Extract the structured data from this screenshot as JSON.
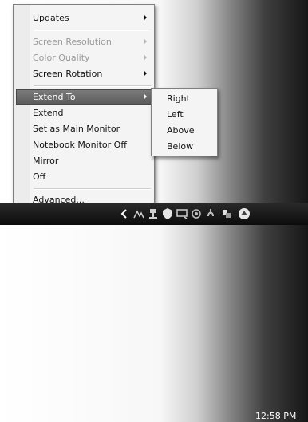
{
  "menu": {
    "items": [
      {
        "label": "Updates",
        "disabled": false,
        "has_submenu": true
      },
      {
        "label": "Screen Resolution",
        "disabled": true,
        "has_submenu": true
      },
      {
        "label": "Color Quality",
        "disabled": true,
        "has_submenu": true
      },
      {
        "label": "Screen Rotation",
        "disabled": false,
        "has_submenu": true
      },
      {
        "label": "Extend To",
        "disabled": false,
        "has_submenu": true,
        "selected": true
      },
      {
        "label": "Extend",
        "disabled": false,
        "has_submenu": false
      },
      {
        "label": "Set as Main Monitor",
        "disabled": false,
        "has_submenu": false
      },
      {
        "label": "Notebook Monitor Off",
        "disabled": false,
        "has_submenu": false
      },
      {
        "label": "Mirror",
        "disabled": false,
        "has_submenu": false
      },
      {
        "label": "Off",
        "disabled": false,
        "has_submenu": false
      },
      {
        "label": "Advanced...",
        "disabled": false,
        "has_submenu": false
      }
    ]
  },
  "submenu": {
    "items": [
      {
        "label": "Right"
      },
      {
        "label": "Left"
      },
      {
        "label": "Above"
      },
      {
        "label": "Below"
      }
    ]
  },
  "taskbar": {
    "clock": "12:58 PM",
    "tray_icons": [
      "chevron-left-icon",
      "network-icon",
      "usb-icon",
      "shield-icon",
      "display-icon",
      "signal-icon",
      "power-icon",
      "monitor-switch-icon"
    ]
  },
  "colors": {
    "menu_bg": "#f4f4f4",
    "selected_bg": "#6a6a6a",
    "disabled_text": "#9a9a9a",
    "taskbar_bg": "#141414"
  }
}
